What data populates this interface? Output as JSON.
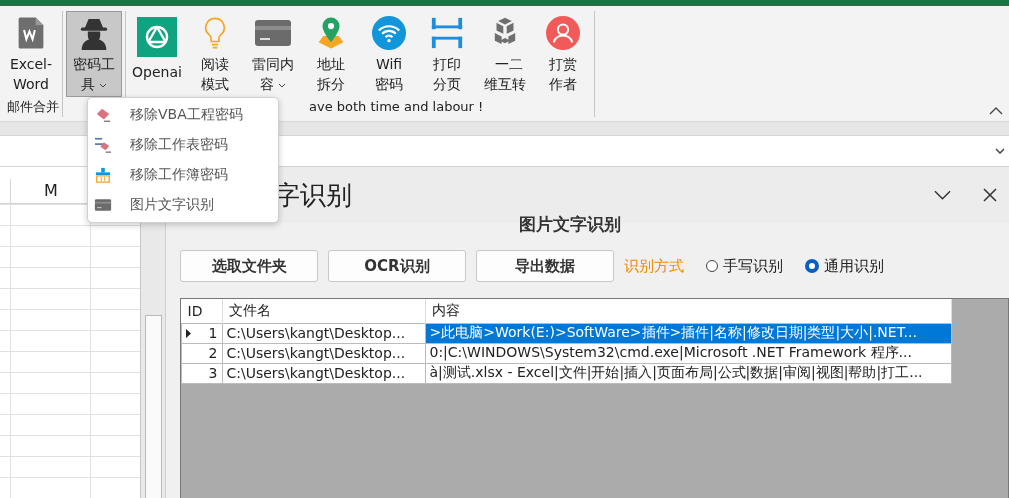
{
  "ribbon": {
    "groups": [
      {
        "label": "邮件合并",
        "buttons": [
          {
            "label": "Excel-\nWord",
            "kind": "word",
            "dropdown": false,
            "pressed": false
          }
        ]
      },
      {
        "buttons": [
          {
            "label": "密码工具",
            "kind": "spy",
            "dropdown": true,
            "pressed": true
          }
        ]
      },
      {
        "label": "ave both time and labour !",
        "buttons": [
          {
            "label": "Openai",
            "kind": "openai",
            "dropdown": false,
            "pressed": false
          },
          {
            "label": "阅读模式",
            "kind": "bulb",
            "dropdown": false,
            "pressed": false
          },
          {
            "label": "雷同内容",
            "kind": "card",
            "dropdown": true,
            "pressed": false
          },
          {
            "label": "地址拆分",
            "kind": "pin",
            "dropdown": false,
            "pressed": false
          },
          {
            "label": "Wifi\n密码",
            "kind": "wifi",
            "dropdown": false,
            "pressed": false
          },
          {
            "label": "打印分页",
            "kind": "print",
            "dropdown": false,
            "pressed": false
          },
          {
            "label": "一二维互转",
            "kind": "cube",
            "dropdown": false,
            "pressed": false
          },
          {
            "label": "打赏作者",
            "kind": "person",
            "dropdown": false,
            "pressed": false
          }
        ]
      }
    ]
  },
  "menu": {
    "items": [
      {
        "label": "移除VBA工程密码",
        "kind": "eraser"
      },
      {
        "label": "移除工作表密码",
        "kind": "sheet-eraser"
      },
      {
        "label": "移除工作簿密码",
        "kind": "brush"
      },
      {
        "label": "图片文字识别",
        "kind": "card"
      }
    ]
  },
  "sheet": {
    "columns": [
      "M"
    ]
  },
  "form": {
    "title": "字识别",
    "heading": "图片文字识别",
    "buttons": [
      "选取文件夹",
      "OCR识别",
      "导出数据"
    ],
    "mode_label": "识别方式",
    "radios": [
      {
        "label": "手写识别",
        "selected": false
      },
      {
        "label": "通用识别",
        "selected": true
      }
    ],
    "table": {
      "columns": [
        "ID",
        "文件名",
        "内容"
      ],
      "rows": [
        {
          "current": true,
          "selected": true,
          "cells": [
            "1",
            "C:\\Users\\kangt\\Desktop...",
            ">此电脑>Work(E:)>SoftWare>插件>插件|名称|修改日期|类型|大小|.NET..."
          ]
        },
        {
          "current": false,
          "selected": false,
          "cells": [
            "2",
            "C:\\Users\\kangt\\Desktop...",
            "0:|C:\\WINDOWS\\System32\\cmd.exe|Microsoft .NET Framework 程序..."
          ]
        },
        {
          "current": false,
          "selected": false,
          "cells": [
            "3",
            "C:\\Users\\kangt\\Desktop...",
            "à|测试.xlsx - Excel|文件|开始|插入|页面布局|公式|数据|审阅|视图|帮助|打工..."
          ]
        }
      ]
    }
  }
}
